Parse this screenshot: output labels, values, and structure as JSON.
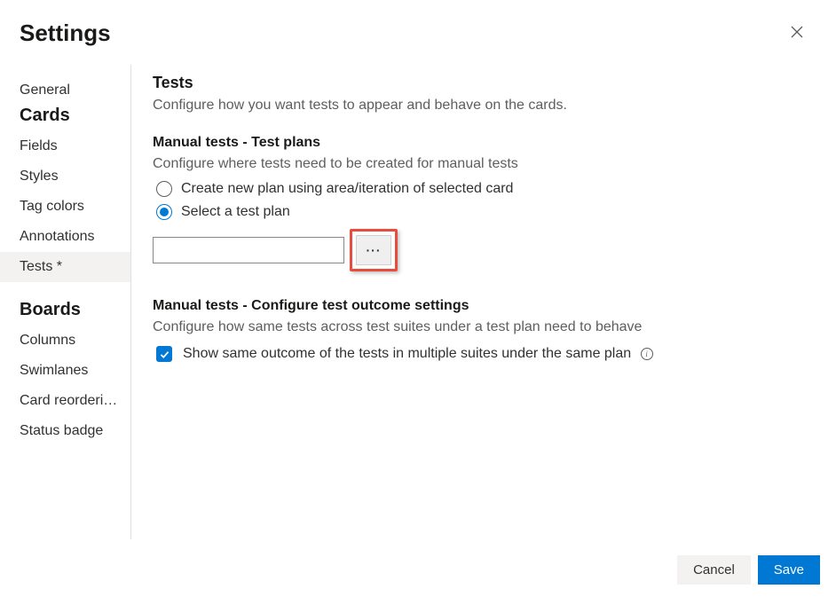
{
  "header": {
    "title": "Settings"
  },
  "sidebar": {
    "general_label": "General",
    "cards_group": "Cards",
    "cards_items": {
      "fields": "Fields",
      "styles": "Styles",
      "tag_colors": "Tag colors",
      "annotations": "Annotations",
      "tests": "Tests *"
    },
    "boards_group": "Boards",
    "boards_items": {
      "columns": "Columns",
      "swimlanes": "Swimlanes",
      "reorder": "Card reorderi…",
      "status_badge": "Status badge"
    }
  },
  "content": {
    "tests": {
      "title": "Tests",
      "desc": "Configure how you want tests to appear and behave on the cards."
    },
    "manual_plans": {
      "title": "Manual tests - Test plans",
      "desc": "Configure where tests need to be created for manual tests",
      "opt_create": "Create new plan using area/iteration of selected card",
      "opt_select": "Select a test plan",
      "plan_value": "",
      "browse_label": "···"
    },
    "outcome": {
      "title": "Manual tests - Configure test outcome settings",
      "desc": "Configure how same tests across test suites under a test plan need to behave",
      "chk_label": "Show same outcome of the tests in multiple suites under the same plan",
      "info_glyph": "i"
    }
  },
  "footer": {
    "cancel": "Cancel",
    "save": "Save"
  }
}
